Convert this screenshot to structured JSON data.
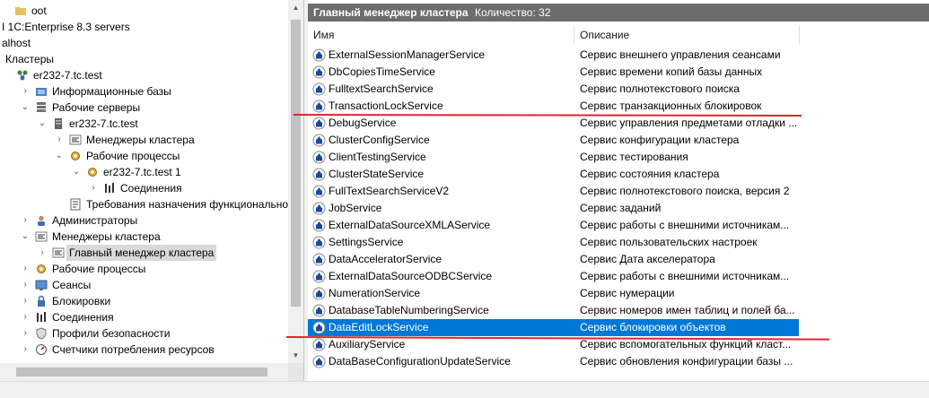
{
  "tree": {
    "nodes": [
      {
        "label": "oot",
        "icon": "folder-icon",
        "arrow": ""
      },
      {
        "label": "I 1C:Enterprise 8.3 servers",
        "icon": "",
        "arrow": ""
      },
      {
        "label": "alhost",
        "icon": "",
        "arrow": ""
      },
      {
        "label": "Кластеры",
        "icon": "",
        "arrow": ""
      },
      {
        "label": "er232-7.tc.test",
        "icon": "cluster-icon",
        "arrow": ""
      },
      {
        "label": "Информационные базы",
        "icon": "database-icon",
        "arrow": "›"
      },
      {
        "label": "Рабочие серверы",
        "icon": "servers-icon",
        "arrow": "⌄"
      },
      {
        "label": "er232-7.tc.test",
        "icon": "server-icon",
        "arrow": "⌄"
      },
      {
        "label": "Менеджеры кластера",
        "icon": "managers-icon",
        "arrow": "›"
      },
      {
        "label": "Рабочие процессы",
        "icon": "processes-icon",
        "arrow": "⌄"
      },
      {
        "label": "er232-7.tc.test 1",
        "icon": "process-icon",
        "arrow": "⌄"
      },
      {
        "label": "Соединения",
        "icon": "connections-icon",
        "arrow": "›"
      },
      {
        "label": "Требования назначения функциональност",
        "icon": "requirements-icon",
        "arrow": ""
      },
      {
        "label": "Администраторы",
        "icon": "admins-icon",
        "arrow": "›"
      },
      {
        "label": "Менеджеры кластера",
        "icon": "managers-icon",
        "arrow": "⌄"
      },
      {
        "label": "Главный менеджер кластера",
        "icon": "manager-icon",
        "arrow": "›"
      },
      {
        "label": "Рабочие процессы",
        "icon": "processes-icon",
        "arrow": "›"
      },
      {
        "label": "Сеансы",
        "icon": "sessions-icon",
        "arrow": "›"
      },
      {
        "label": "Блокировки",
        "icon": "locks-icon",
        "arrow": "›"
      },
      {
        "label": "Соединения",
        "icon": "connections-icon",
        "arrow": "›"
      },
      {
        "label": "Профили безопасности",
        "icon": "security-profiles-icon",
        "arrow": "›"
      },
      {
        "label": "Счетчики потребления ресурсов",
        "icon": "counters-icon",
        "arrow": "›"
      }
    ]
  },
  "panel": {
    "title": "Главный менеджер кластера",
    "count": "Количество: 32",
    "col_name": "Имя",
    "col_desc": "Описание"
  },
  "rows": [
    {
      "name": "ExternalSessionManagerService",
      "desc": "Сервис внешнего управления сеансами"
    },
    {
      "name": "DbCopiesTimeService",
      "desc": "Сервис времени копий базы данных"
    },
    {
      "name": "FulltextSearchService",
      "desc": "Сервис полнотекстового поиска"
    },
    {
      "name": "TransactionLockService",
      "desc": "Сервис транзакционных блокировок"
    },
    {
      "name": "DebugService",
      "desc": "Сервис управления предметами отладки ..."
    },
    {
      "name": "ClusterConfigService",
      "desc": "Сервис конфигурации кластера"
    },
    {
      "name": "ClientTestingService",
      "desc": "Сервис тестирования"
    },
    {
      "name": "ClusterStateService",
      "desc": "Сервис состояния кластера"
    },
    {
      "name": "FullTextSearchServiceV2",
      "desc": "Сервис полнотекстового поиска, версия 2"
    },
    {
      "name": "JobService",
      "desc": "Сервис заданий"
    },
    {
      "name": "ExternalDataSourceXMLAService",
      "desc": "Сервис работы с внешними источникам..."
    },
    {
      "name": "SettingsService",
      "desc": "Сервис пользовательских настроек"
    },
    {
      "name": "DataAcceleratorService",
      "desc": "Сервис Дата акселератора"
    },
    {
      "name": "ExternalDataSourceODBCService",
      "desc": "Сервис работы с внешними источникам..."
    },
    {
      "name": "NumerationService",
      "desc": "Сервис нумерации"
    },
    {
      "name": "DatabaseTableNumberingService",
      "desc": "Сервис номеров имен таблиц и полей ба..."
    },
    {
      "name": "DataEditLockService",
      "desc": "Сервис блокировки объектов"
    },
    {
      "name": "AuxiliaryService",
      "desc": "Сервис вспомогательных функций класт..."
    },
    {
      "name": "DataBaseConfigurationUpdateService",
      "desc": "Сервис обновления конфигурации базы ..."
    }
  ],
  "selected_row": "DataEditLockService",
  "selected_tree_node": "Главный менеджер кластера",
  "colors": {
    "selection": "#0078d7",
    "annotation": "#e3242b",
    "header": "#6d6d6d"
  }
}
